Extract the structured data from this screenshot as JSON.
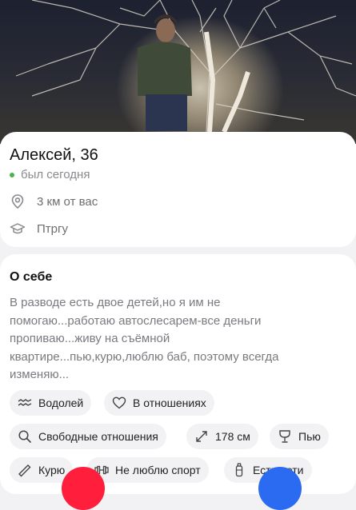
{
  "profile": {
    "name_age": "Алексей, 36",
    "status": "был сегодня",
    "distance": "3 км от вас",
    "education": "Птргу"
  },
  "about": {
    "title": "О себе",
    "lines": [
      "В разводе есть двое детей,но я им не",
      "помогаю...работаю автослесарем-все деньги",
      "пропиваю...живу на съёмной",
      "квартире...пью,курю,люблю баб, поэтому всегда",
      "изменяю..."
    ]
  },
  "tags": {
    "zodiac": "Водолей",
    "relationship": "В отношениях",
    "looking_for": "Свободные отношения",
    "height": "178 см",
    "alcohol": "Пью",
    "smoking": "Курю",
    "sport": "Не люблю спорт",
    "kids": "Есть дети"
  },
  "colors": {
    "online_dot": "#4bb34b",
    "dislike_button": "#ff1f3d",
    "like_button": "#2a6bf2"
  },
  "icons": {
    "location": "location-pin-icon",
    "education": "graduation-cap-icon",
    "zodiac": "aquarius-icon",
    "relationship": "heart-icon",
    "looking_for": "search-icon",
    "height": "height-arrows-icon",
    "alcohol": "wine-glass-icon",
    "smoking": "cigarette-icon",
    "sport": "dumbbell-icon",
    "kids": "baby-bottle-icon"
  }
}
